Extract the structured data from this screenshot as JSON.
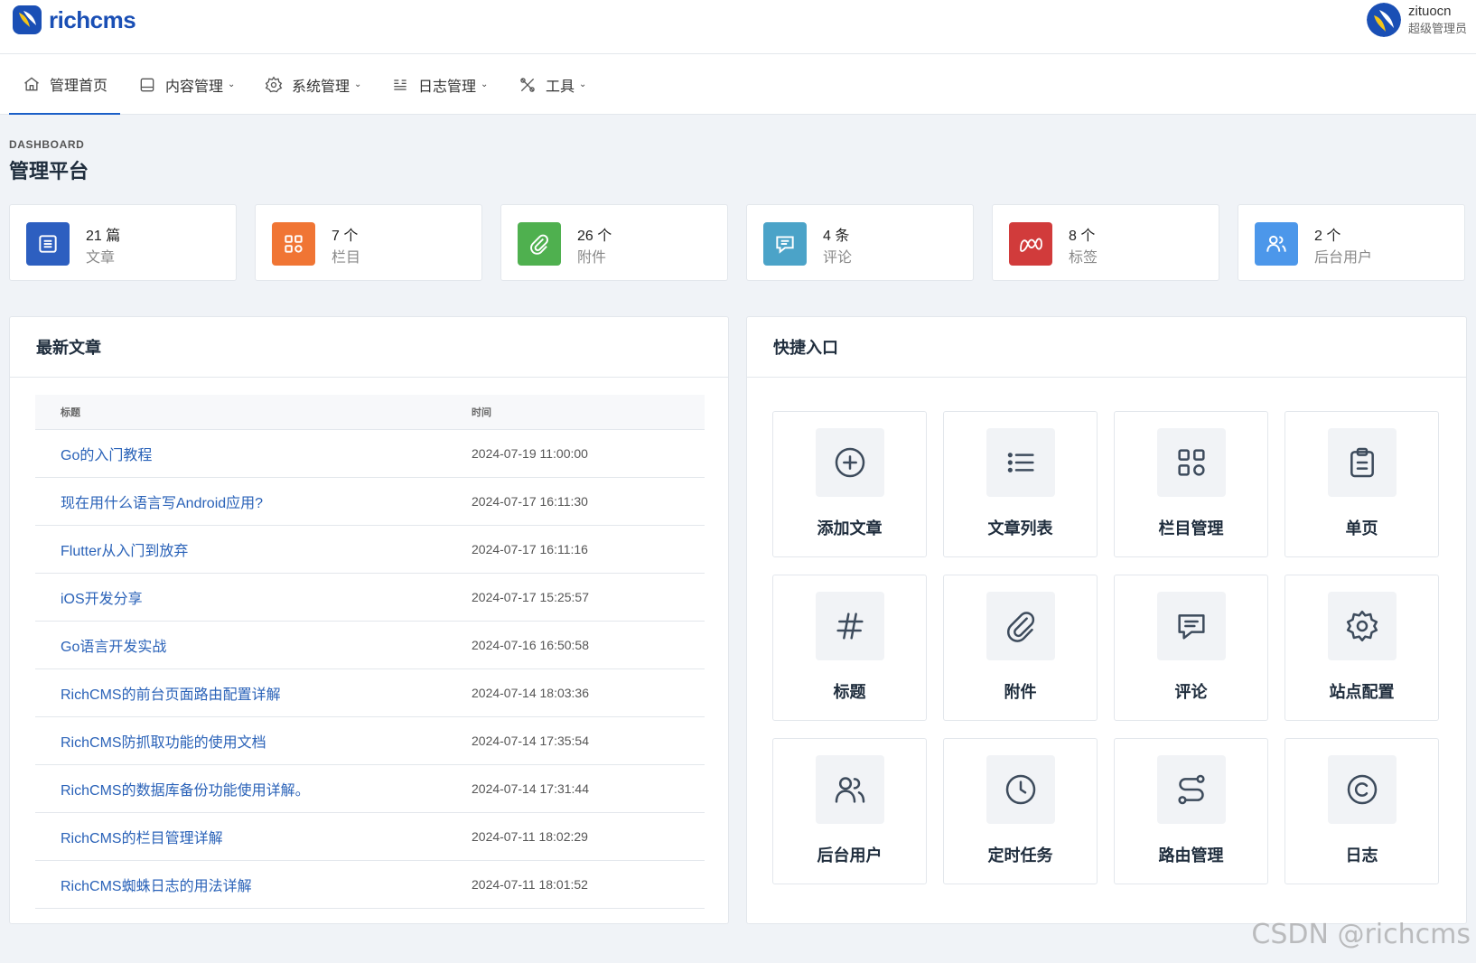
{
  "brand": {
    "name": "richcms"
  },
  "user": {
    "name": "zituocn",
    "role": "超级管理员"
  },
  "nav": [
    {
      "label": "管理首页",
      "icon": "home-icon",
      "active": true
    },
    {
      "label": "内容管理",
      "icon": "content-icon"
    },
    {
      "label": "系统管理",
      "icon": "gear-icon"
    },
    {
      "label": "日志管理",
      "icon": "log-icon"
    },
    {
      "label": "工具",
      "icon": "tools-icon"
    }
  ],
  "page": {
    "pretitle": "DASHBOARD",
    "title": "管理平台"
  },
  "stats": [
    {
      "value": "21 篇",
      "label": "文章",
      "color": "#2d5fc0",
      "icon": "article-icon"
    },
    {
      "value": "7 个",
      "label": "栏目",
      "color": "#f07534",
      "icon": "grid-icon"
    },
    {
      "value": "26 个",
      "label": "附件",
      "color": "#4fb04f",
      "icon": "paperclip-icon"
    },
    {
      "value": "4 条",
      "label": "评论",
      "color": "#4ba3c8",
      "icon": "comment-icon"
    },
    {
      "value": "8 个",
      "label": "标签",
      "color": "#d13b3b",
      "icon": "tag-icon"
    },
    {
      "value": "2 个",
      "label": "后台用户",
      "color": "#4c97ea",
      "icon": "users-icon"
    }
  ],
  "latest": {
    "title": "最新文章",
    "columns": [
      "标题",
      "时间"
    ],
    "rows": [
      {
        "title": "Go的入门教程",
        "time": "2024-07-19 11:00:00"
      },
      {
        "title": "现在用什么语言写Android应用?",
        "time": "2024-07-17 16:11:30"
      },
      {
        "title": "Flutter从入门到放弃",
        "time": "2024-07-17 16:11:16"
      },
      {
        "title": "iOS开发分享",
        "time": "2024-07-17 15:25:57"
      },
      {
        "title": "Go语言开发实战",
        "time": "2024-07-16 16:50:58"
      },
      {
        "title": "RichCMS的前台页面路由配置详解",
        "time": "2024-07-14 18:03:36"
      },
      {
        "title": "RichCMS防抓取功能的使用文档",
        "time": "2024-07-14 17:35:54"
      },
      {
        "title": "RichCMS的数据库备份功能使用详解。",
        "time": "2024-07-14 17:31:44"
      },
      {
        "title": "RichCMS的栏目管理详解",
        "time": "2024-07-11 18:02:29"
      },
      {
        "title": "RichCMS蜘蛛日志的用法详解",
        "time": "2024-07-11 18:01:52"
      }
    ]
  },
  "shortcuts": {
    "title": "快捷入口",
    "items": [
      {
        "label": "添加文章",
        "icon": "plus-circle-icon"
      },
      {
        "label": "文章列表",
        "icon": "list-icon"
      },
      {
        "label": "栏目管理",
        "icon": "grid-icon"
      },
      {
        "label": "单页",
        "icon": "clipboard-icon"
      },
      {
        "label": "标题",
        "icon": "hash-icon"
      },
      {
        "label": "附件",
        "icon": "paperclip-icon"
      },
      {
        "label": "评论",
        "icon": "comment-icon"
      },
      {
        "label": "站点配置",
        "icon": "gear-icon"
      },
      {
        "label": "后台用户",
        "icon": "users-icon"
      },
      {
        "label": "定时任务",
        "icon": "clock-icon"
      },
      {
        "label": "路由管理",
        "icon": "route-icon"
      },
      {
        "label": "日志",
        "icon": "copyright-icon"
      }
    ]
  },
  "watermark": "CSDN @richcms"
}
